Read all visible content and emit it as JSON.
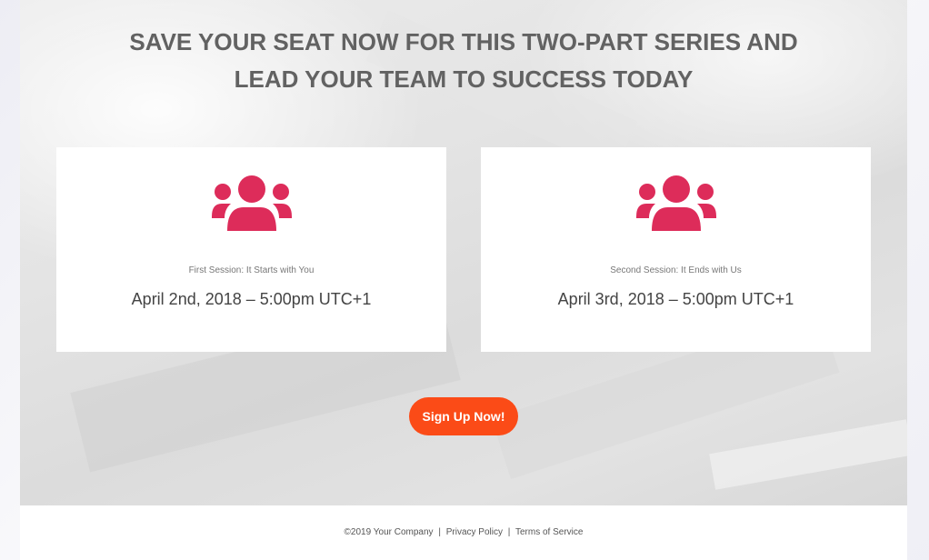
{
  "headline": "SAVE YOUR SEAT NOW FOR THIS TWO-PART SERIES AND LEAD YOUR TEAM TO SUCCESS TODAY",
  "colors": {
    "accent": "#dd2c5a",
    "cta": "#fb4b17",
    "headline": "#626262"
  },
  "sessions": [
    {
      "icon": "group-icon",
      "subtitle": "First Session: It Starts with You",
      "date": "April 2nd, 2018 – 5:00pm UTC+1"
    },
    {
      "icon": "group-icon",
      "subtitle": "Second Session: It Ends with Us",
      "date": "April 3rd, 2018 – 5:00pm UTC+1"
    }
  ],
  "cta": {
    "label": "Sign Up Now!"
  },
  "footer": {
    "copyright": "©2019 Your Company",
    "separator": "|",
    "privacy": "Privacy Policy",
    "terms": "Terms of Service"
  }
}
